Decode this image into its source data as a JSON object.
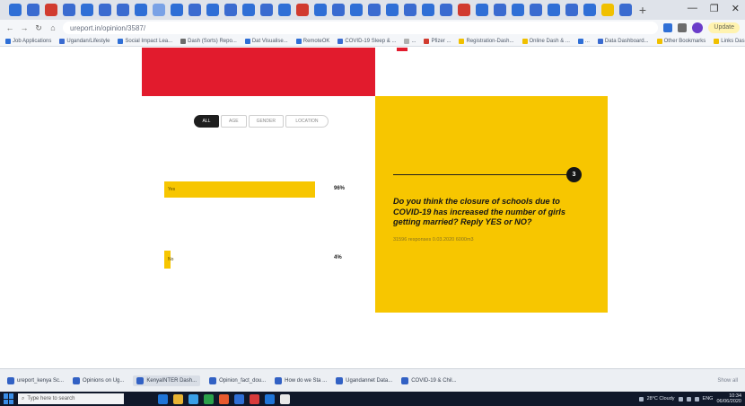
{
  "browser": {
    "tab_icon_colors": [
      "#2f6fd6",
      "#3a6bd0",
      "#d13b2f",
      "#3a6bd0",
      "#2f6fd6",
      "#3a6bd0",
      "#3a6bd0",
      "#2f6fd6",
      "#7aa2e6",
      "#2f6fd6",
      "#3a6bd0",
      "#2f6fd6",
      "#3a6bd0",
      "#2f6fd6",
      "#3a6bd0",
      "#2f6fd6",
      "#d13b2f",
      "#2f6fd6",
      "#3a6bd0",
      "#2f6fd6",
      "#3a6bd0",
      "#2f6fd6",
      "#3a6bd0",
      "#2f6fd6",
      "#3a6bd0",
      "#d13b2f",
      "#2f6fd6",
      "#3a6bd0",
      "#2f6fd6",
      "#3a6bd0",
      "#2f6fd6",
      "#3a6bd0",
      "#2f6fd6",
      "#f0c000",
      "#3a6bd0"
    ],
    "new_tab_glyph": "+",
    "controls": {
      "minimize": "—",
      "maximize": "❐",
      "close": "✕"
    },
    "nav": {
      "back": "←",
      "forward": "→",
      "reload": "↻",
      "home": "⌂"
    },
    "url": "ureport.in/opinion/3587/",
    "bookmarks": [
      "Job Applications",
      "Ugandan/Lifestyle",
      "Social Impact Lea...",
      "Dash (Sorts) Repo...",
      "Dat Visualise...",
      "RemoteOK",
      "COVID-19 Sleep & ...",
      "...",
      "Pfizer ...",
      "Registration-Dash...",
      "Online Dash & ...",
      "...",
      "Data Dashboard...",
      "Other Bookmarks",
      "Links Dashboard"
    ],
    "bookmark_colors": [
      "#2f6fd6",
      "#3a6bd0",
      "#2f6fd6",
      "#6b6b6b",
      "#2f6fd6",
      "#2f6fd6",
      "#3a6bd0",
      "#b0b0b0",
      "#d13b2f",
      "#f0c000",
      "#f0c000",
      "#2f6fd6",
      "#3a6bd0",
      "#f0c000",
      "#f0c000"
    ],
    "sync_label": "Update"
  },
  "page": {
    "filters": [
      "ALL",
      "AGE",
      "GENDER",
      "LOCATION"
    ],
    "responses": [
      {
        "label": "Yes",
        "percent": "96%",
        "fraction": 0.96
      },
      {
        "label": "No",
        "percent": "4%",
        "fraction": 0.04
      }
    ],
    "quiz": {
      "number": "3",
      "question": "Do you think the closure of schools due to COVID-19 has increased the number of girls getting married? Reply YES or NO?",
      "meta": "31596 responses 0.03.2020 6000m3"
    },
    "colors": {
      "accent_red": "#e21b2d",
      "accent_yellow": "#f7c600",
      "dark": "#1e1e1e"
    }
  },
  "windows_strip": {
    "items": [
      "ureport_kenya Sc...",
      "Opinions on Ug...",
      "KenyaINTER Dash...",
      "Opinion_fact_dou...",
      "How do we Sta ...",
      "Ugandannet Data...",
      "COVID-19 & Chil..."
    ],
    "right_label": "Show all"
  },
  "taskbar": {
    "search_placeholder": "Type here to search",
    "icon_colors": [
      "#1f75d8",
      "#e8b434",
      "#3aa0e8",
      "#2aa14a",
      "#e85a2e",
      "#2f6fd6",
      "#d83b3b",
      "#1f75d8",
      "#e8e8e8"
    ],
    "weather": "28°C Cloudy",
    "lang": "ENG",
    "time": "10:34",
    "date": "06/06/2020"
  }
}
